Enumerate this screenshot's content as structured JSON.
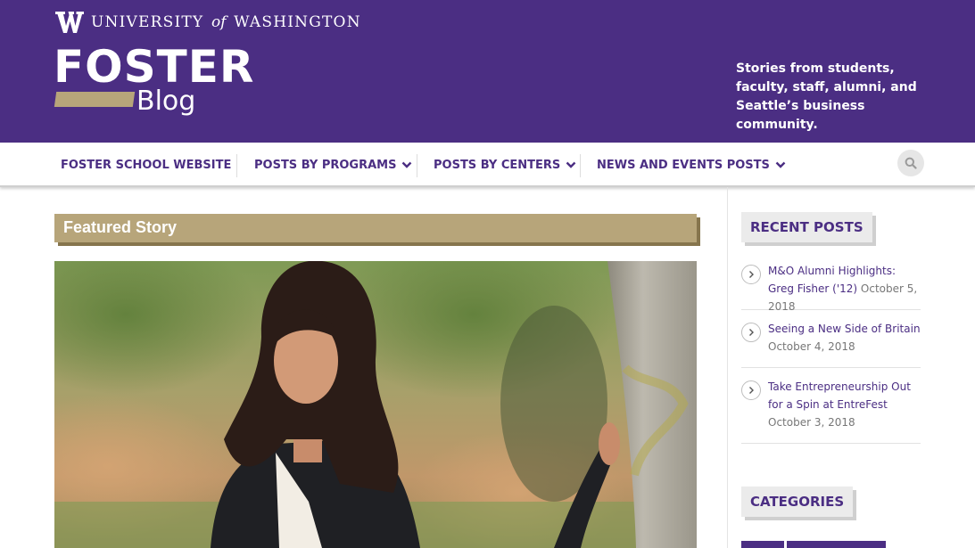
{
  "header": {
    "university_prefix": "UNIVERSITY",
    "university_of": "of",
    "university_suffix": "WASHINGTON",
    "logo_main": "FOSTER",
    "logo_sub": "Blog",
    "tagline": "Stories from students, faculty, staff, alumni, and Seattle’s business community."
  },
  "nav": {
    "items": [
      {
        "label": "FOSTER SCHOOL WEBSITE",
        "has_dropdown": false
      },
      {
        "label": "POSTS BY PROGRAMS",
        "has_dropdown": true
      },
      {
        "label": "POSTS BY CENTERS",
        "has_dropdown": true
      },
      {
        "label": "NEWS AND EVENTS POSTS",
        "has_dropdown": true
      }
    ],
    "search_icon": "search-icon"
  },
  "main": {
    "featured_title": "Featured Story"
  },
  "sidebar": {
    "recent_title": "RECENT POSTS",
    "posts": [
      {
        "title": "M&O Alumni Highlights: Greg Fisher ('12)",
        "date": "October 5, 2018"
      },
      {
        "title": "Seeing a New Side of Britain",
        "date": "October 4, 2018"
      },
      {
        "title": "Take Entrepreneurship Out for a Spin at EntreFest",
        "date": "October 3, 2018"
      }
    ],
    "categories_title": "CATEGORIES"
  },
  "colors": {
    "brand_purple": "#4b2e83",
    "brand_gold": "#b7a57a"
  }
}
